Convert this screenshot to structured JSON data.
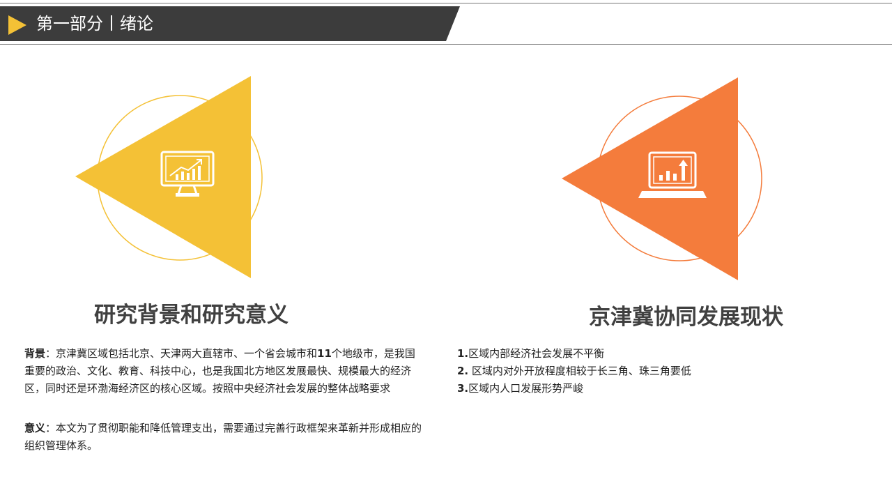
{
  "header": {
    "title": "第一部分丨绪论",
    "bar_color": "#3c3c3c",
    "arrow_color": "#f4c136"
  },
  "sections": [
    {
      "icon": "monitor-chart-icon",
      "color": "#f4c136",
      "heading": "研究背景和研究意义"
    },
    {
      "icon": "laptop-chart-icon",
      "color": "#f47c3c",
      "heading": "京津冀协同发展现状"
    }
  ],
  "background": {
    "label": "背景",
    "text_a": "：京津冀区域包括北京、天津两大直辖市、一个省会城市和",
    "number": "11",
    "text_b": "个地级市，是我国重要的政治、文化、教育、科技中心，也是我国北方地区发展最快、规模最大的经济区，同时还是环渤海经济区的核心区域。按照中央经济社会发展的整体战略要求"
  },
  "significance": {
    "label": "意义",
    "text": "：本文为了贯彻职能和降低管理支出，需要通过完善行政框架来革新并形成相应的组织管理体系。"
  },
  "status_list": [
    {
      "num": "1.",
      "text": "区域内部经济社会发展不平衡"
    },
    {
      "num": "2.",
      "text": " 区域内对外开放程度相较于长三角、珠三角要低"
    },
    {
      "num": "3.",
      "text": "区域内人口发展形势严峻"
    }
  ]
}
